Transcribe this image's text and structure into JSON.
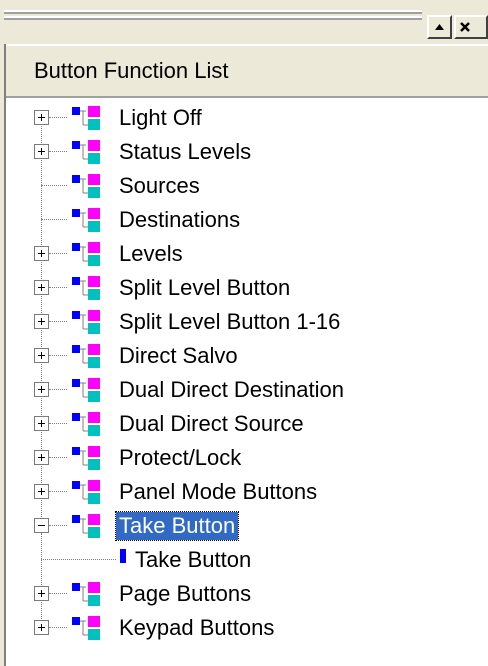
{
  "window": {
    "scroll_up_icon": "triangle-up-icon",
    "close_icon": "close-x-icon"
  },
  "header": {
    "title": "Button Function List"
  },
  "tree": {
    "items": [
      {
        "label": "Light Off",
        "expander": "plus"
      },
      {
        "label": "Status Levels",
        "expander": "plus"
      },
      {
        "label": "Sources",
        "expander": "none"
      },
      {
        "label": "Destinations",
        "expander": "none"
      },
      {
        "label": "Levels",
        "expander": "plus"
      },
      {
        "label": "Split Level Button",
        "expander": "plus"
      },
      {
        "label": "Split Level Button 1-16",
        "expander": "plus"
      },
      {
        "label": "Direct Salvo",
        "expander": "plus"
      },
      {
        "label": "Dual Direct Destination",
        "expander": "plus"
      },
      {
        "label": "Dual Direct Source",
        "expander": "plus"
      },
      {
        "label": "Protect/Lock",
        "expander": "plus"
      },
      {
        "label": "Panel Mode Buttons",
        "expander": "plus"
      },
      {
        "label": "Take Button",
        "expander": "minus",
        "selected": true
      },
      {
        "label": "Page Buttons",
        "expander": "plus"
      },
      {
        "label": "Keypad Buttons",
        "expander": "plus"
      }
    ],
    "child": {
      "parent": "Take Button",
      "label": "Take Button"
    }
  },
  "colors": {
    "selection": "#316ac5",
    "icon_blue": "#0000ff",
    "icon_magenta": "#ff00ff",
    "icon_cyan": "#00c0c0",
    "chrome": "#ece9d8"
  }
}
